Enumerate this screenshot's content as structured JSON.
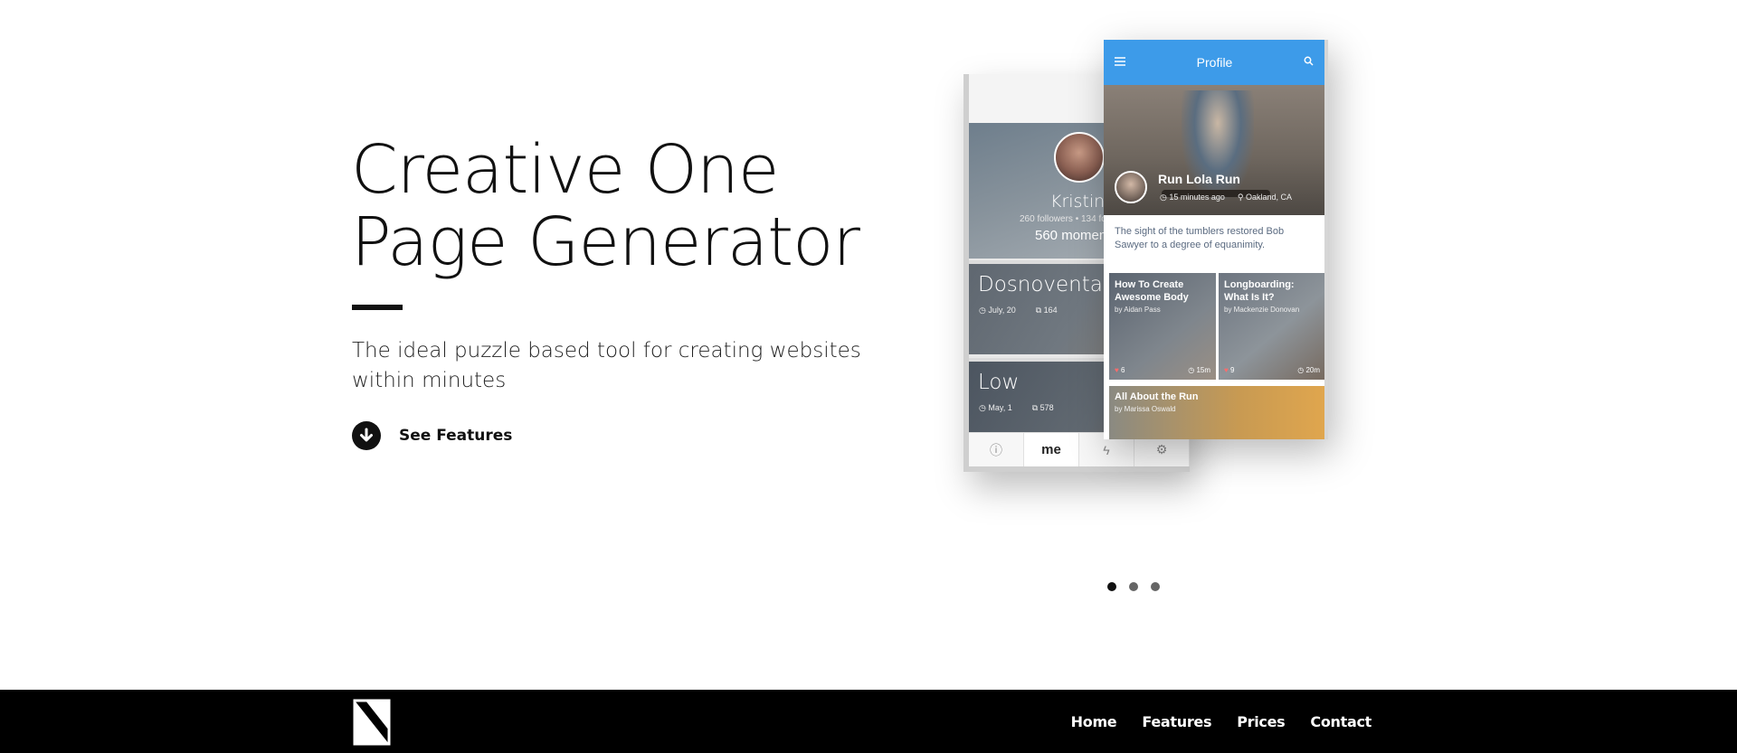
{
  "hero": {
    "title_line1": "Creative One",
    "title_line2": "Page Generator",
    "subtitle": "The ideal puzzle based tool for creating websites within minutes",
    "cta_label": "See Features"
  },
  "mockup": {
    "back_phone": {
      "profile_name": "Kristina",
      "profile_stats": "260 followers  •  134 fo",
      "profile_moments": "560 momen",
      "cards": [
        {
          "title": "Dosnoventa",
          "date": "July, 20",
          "count": "164"
        },
        {
          "title": "Low",
          "date": "May, 1",
          "count": "578"
        }
      ],
      "tabbar": {
        "info_icon": "info-icon",
        "me_label": "me",
        "activity_icon": "bolt-icon",
        "settings_icon": "gear-icon"
      }
    },
    "front_phone": {
      "appbar_title": "Profile",
      "post_title": "Run Lola Run",
      "post_time": "15 minutes ago",
      "post_location": "Oakland, CA",
      "quote": "The sight of the tumblers restored Bob Sawyer to a degree of equanimity.",
      "tiles": [
        {
          "title": "How To Create Awesome Body",
          "author": "by Aidan Pass",
          "likes": "6",
          "duration": "15m"
        },
        {
          "title": "Longboarding: What Is It?",
          "author": "by Mackenzie Donovan",
          "likes": "9",
          "duration": "20m"
        }
      ],
      "wide_tile": {
        "title": "All About the Run",
        "author": "by Marissa Oswald"
      }
    }
  },
  "carousel": {
    "dot_count": 3,
    "active_index": 0
  },
  "footer": {
    "nav": [
      "Home",
      "Features",
      "Prices",
      "Contact"
    ]
  },
  "colors": {
    "accent_blue": "#3d9be9",
    "footer_bg": "#000000",
    "text_dark": "#111111"
  }
}
